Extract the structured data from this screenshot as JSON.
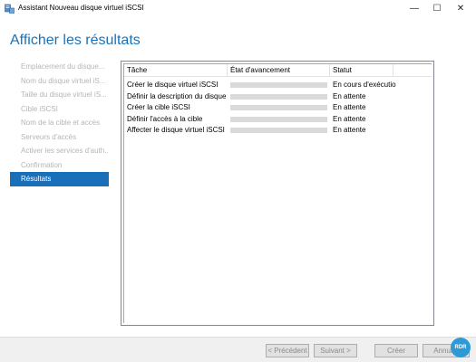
{
  "window": {
    "title": "Assistant Nouveau disque virtuel iSCSI",
    "icon": "server-manager-icon",
    "controls": {
      "minimize": "—",
      "maximize": "☐",
      "close": "✕"
    }
  },
  "page": {
    "heading": "Afficher les résultats"
  },
  "nav": {
    "items": [
      {
        "label": "Emplacement du disque..."
      },
      {
        "label": "Nom du disque virtuel iS..."
      },
      {
        "label": "Taille du disque virtuel iS..."
      },
      {
        "label": "Cible iSCSI"
      },
      {
        "label": "Nom de la cible et accès"
      },
      {
        "label": "Serveurs d'accès"
      },
      {
        "label": "Activer les services d'auth..."
      },
      {
        "label": "Confirmation"
      },
      {
        "label": "Résultats"
      }
    ],
    "active_index": 8
  },
  "table": {
    "headers": {
      "task": "Tâche",
      "progress": "État d'avancement",
      "status": "Statut"
    },
    "rows": [
      {
        "task": "Créer le disque virtuel iSCSI",
        "progress": 0,
        "status": "En cours d'exécution"
      },
      {
        "task": "Définir la description du disque virtuel",
        "progress": 0,
        "status": "En attente"
      },
      {
        "task": "Créer la cible iSCSI",
        "progress": 0,
        "status": "En attente"
      },
      {
        "task": "Définir l'accès à la cible",
        "progress": 0,
        "status": "En attente"
      },
      {
        "task": "Affecter le disque virtuel iSCSI à la cible",
        "progress": 0,
        "status": "En attente"
      }
    ]
  },
  "footer": {
    "prev_label": "< Précédent",
    "next_label": "Suivant >",
    "create_label": "Créer",
    "cancel_label": "Annuler",
    "badge_text": "RDR"
  },
  "colors": {
    "heading": "#1a73b8",
    "nav_active_bg": "#1a6fb9",
    "nav_disabled_text": "#b5b5b5",
    "progress_track": "#dadada",
    "footer_bg": "#f0f0f0"
  }
}
